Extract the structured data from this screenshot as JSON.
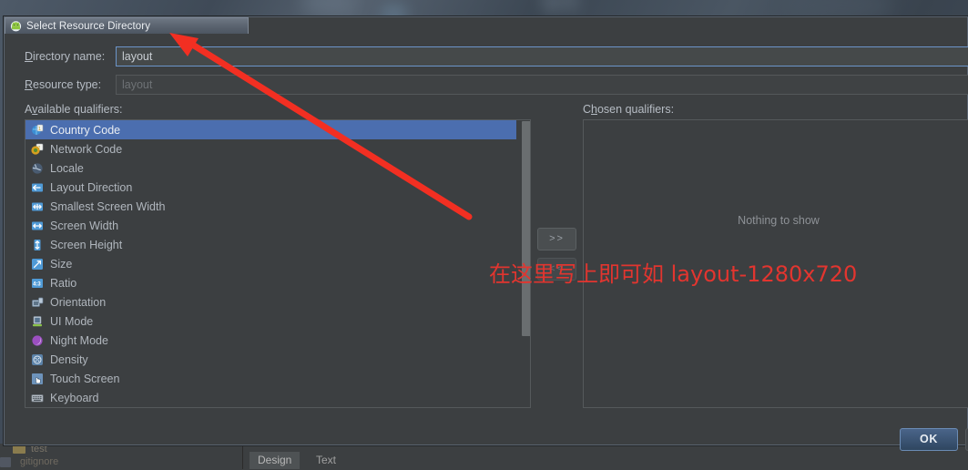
{
  "window": {
    "title": "Select Resource Directory",
    "icon": "android-robot-icon"
  },
  "form": {
    "directory_name_label": "Directory name:",
    "directory_name_value": "layout",
    "resource_type_label": "Resource type:",
    "resource_type_value": "layout"
  },
  "panels": {
    "available_label": "Available qualifiers:",
    "chosen_label": "Chosen qualifiers:",
    "chosen_empty_text": "Nothing to show"
  },
  "available_qualifiers": [
    {
      "label": "Country Code",
      "icon": "country-code-icon",
      "selected": true
    },
    {
      "label": "Network Code",
      "icon": "network-code-icon",
      "selected": false
    },
    {
      "label": "Locale",
      "icon": "locale-globe-icon",
      "selected": false
    },
    {
      "label": "Layout Direction",
      "icon": "layout-direction-icon",
      "selected": false
    },
    {
      "label": "Smallest Screen Width",
      "icon": "smallest-screen-width-icon",
      "selected": false
    },
    {
      "label": "Screen Width",
      "icon": "screen-width-icon",
      "selected": false
    },
    {
      "label": "Screen Height",
      "icon": "screen-height-icon",
      "selected": false
    },
    {
      "label": "Size",
      "icon": "size-icon",
      "selected": false
    },
    {
      "label": "Ratio",
      "icon": "ratio-icon",
      "selected": false
    },
    {
      "label": "Orientation",
      "icon": "orientation-icon",
      "selected": false
    },
    {
      "label": "UI Mode",
      "icon": "ui-mode-icon",
      "selected": false
    },
    {
      "label": "Night Mode",
      "icon": "night-mode-icon",
      "selected": false
    },
    {
      "label": "Density",
      "icon": "density-icon",
      "selected": false
    },
    {
      "label": "Touch Screen",
      "icon": "touch-screen-icon",
      "selected": false
    },
    {
      "label": "Keyboard",
      "icon": "keyboard-icon",
      "selected": false
    }
  ],
  "transfer_buttons": {
    "add_label": ">>",
    "remove_label": "<<"
  },
  "footer": {
    "ok_label": "OK"
  },
  "annotation": {
    "text": "在这里写上即可如 layout-1280x720",
    "color": "#e2352f",
    "arrow": "red-arrow-pointing-to-directory-name-field"
  },
  "editor_tabs": {
    "design_label": "Design",
    "text_label": "Text"
  },
  "project_tree": {
    "row1": "test",
    "row2": "gitignore"
  },
  "colors": {
    "dialog_bg": "#3c3f41",
    "selection_blue": "#4b6eaf",
    "field_border_focus": "#6b94c9",
    "text_primary": "#b0b6bd",
    "annotation_red": "#e2352f",
    "ok_button_blue": "#3b5473"
  }
}
